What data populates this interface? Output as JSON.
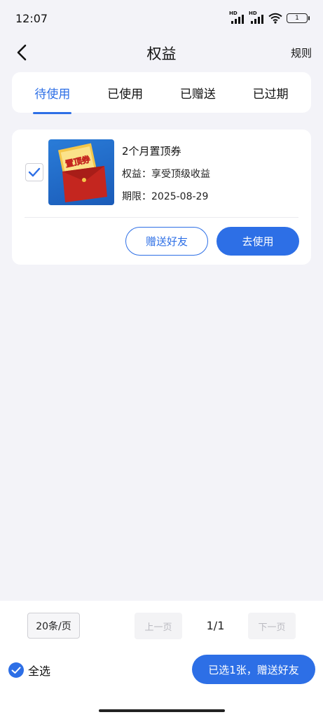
{
  "status": {
    "time": "12:07",
    "hd1": "HD",
    "hd2": "HD",
    "battery": "1"
  },
  "header": {
    "title": "权益",
    "rule": "规则"
  },
  "tabs": [
    {
      "label": "待使用",
      "active": true
    },
    {
      "label": "已使用",
      "active": false
    },
    {
      "label": "已赠送",
      "active": false
    },
    {
      "label": "已过期",
      "active": false
    }
  ],
  "coupon": {
    "checked": true,
    "image_text": "置顶券",
    "name": "2个月置顶券",
    "benefit": "权益：享受顶级收益",
    "expiry": "期限：2025-08-29",
    "gift_button": "赠送好友",
    "use_button": "去使用"
  },
  "pagination": {
    "page_size": "20条/页",
    "prev": "上一页",
    "indicator": "1/1",
    "next": "下一页"
  },
  "footer": {
    "select_all": "全选",
    "gift_selected": "已选1张，赠送好友"
  },
  "colors": {
    "accent": "#2d6fe6",
    "background": "#f3f3f8",
    "coupon_red": "#c4261f"
  }
}
